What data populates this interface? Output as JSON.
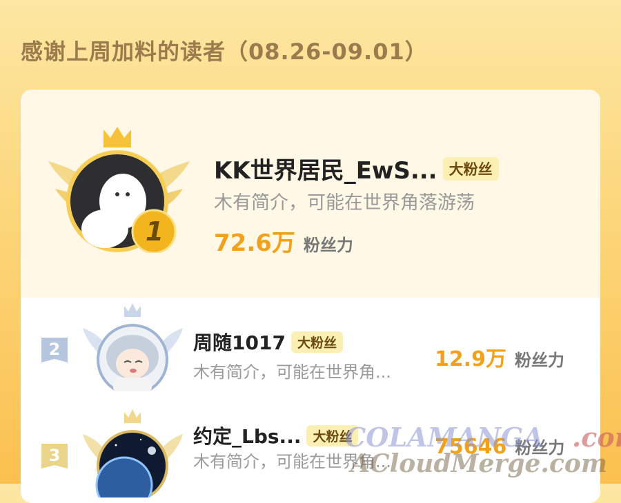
{
  "header": {
    "title": "感谢上周加料的读者（08.26-09.01）"
  },
  "top_rank": {
    "rank": "1",
    "name": "KK世界居民_EwS...",
    "badge": "大粉丝",
    "desc": "木有简介，可能在世界角落游荡",
    "fans_value": "72.6万",
    "fans_label": "粉丝力"
  },
  "ranks": [
    {
      "rank": "2",
      "name": "周随1017",
      "badge": "大粉丝",
      "desc": "木有简介，可能在世界角...",
      "fans_value": "12.9万",
      "fans_label": "粉丝力"
    },
    {
      "rank": "3",
      "name": "约定_Lbs...",
      "badge": "大粉丝",
      "desc": "木有简介，可能在世界角...",
      "fans_value": "75646",
      "fans_label": "粉丝力"
    }
  ],
  "watermark": {
    "line1": "COLAMANGA",
    "line1_suffix": ".com",
    "line2": "ACloudMerge.com"
  },
  "colors": {
    "accent": "#f2a21a",
    "badge_bg": "#fcefb3",
    "gold_medal": "#f2b51e",
    "silver": "#b6c6de"
  }
}
